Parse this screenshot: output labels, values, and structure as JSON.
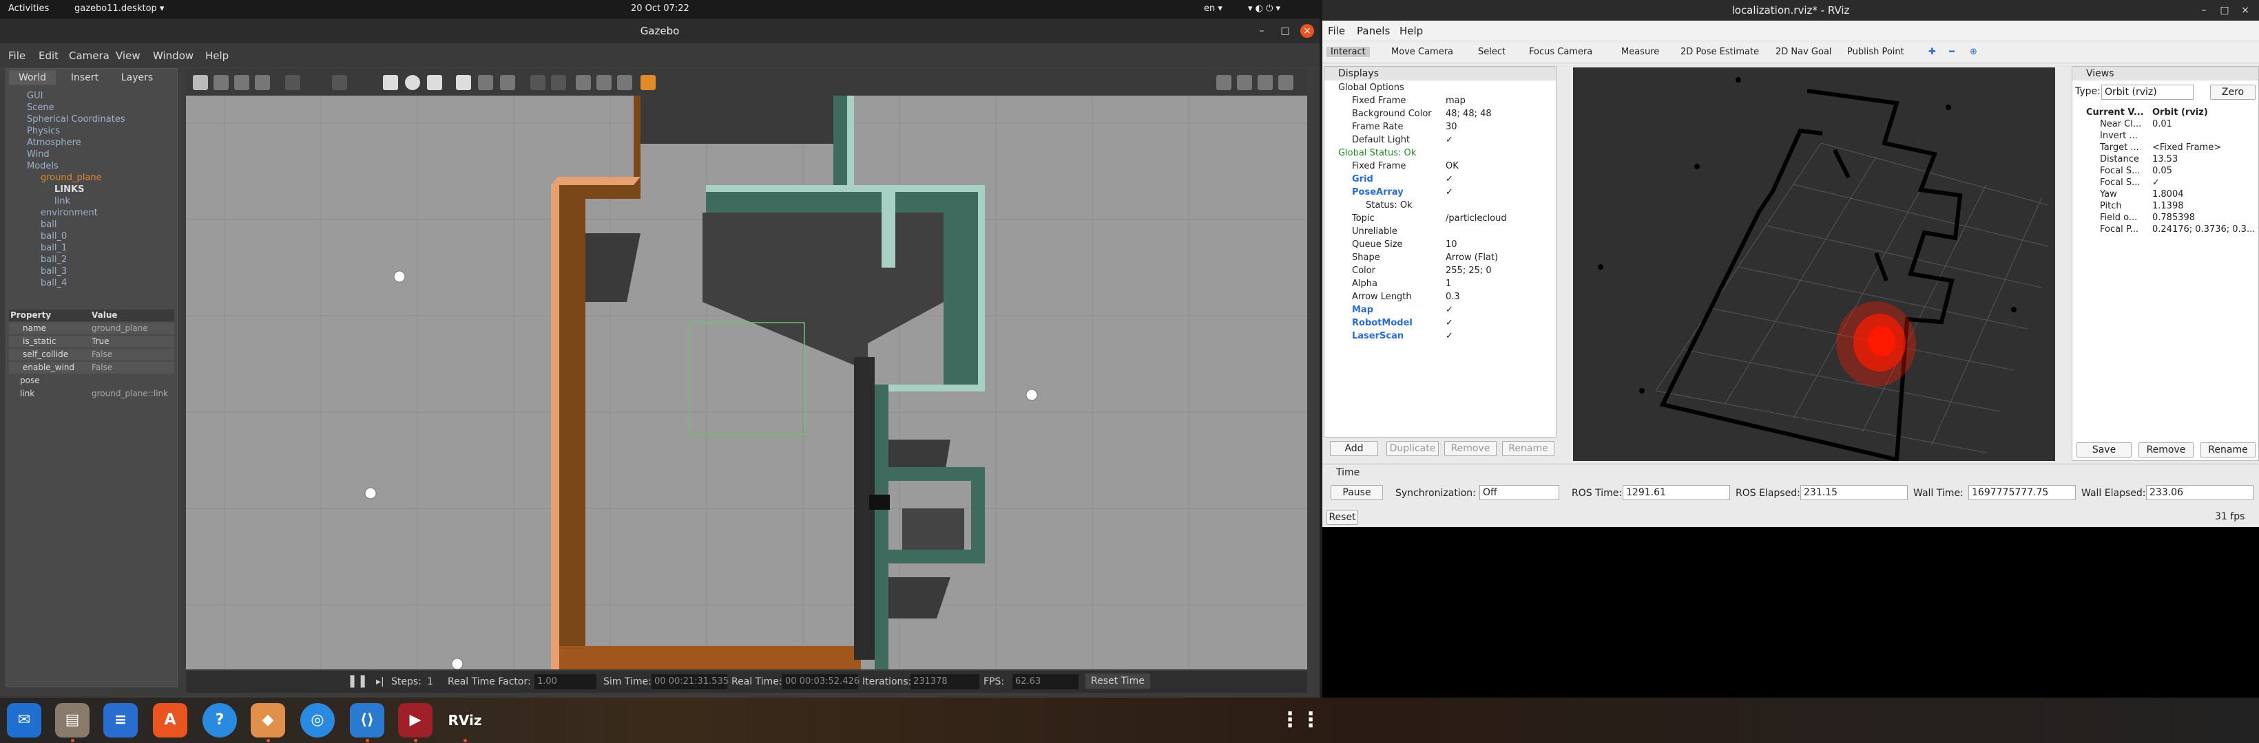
{
  "topbar": {
    "activities": "Activities",
    "app": "gazebo11.desktop ▾",
    "clock": "20 Oct  07:22",
    "lang": "en ▾"
  },
  "gazebo": {
    "title": "Gazebo",
    "menu": [
      "File",
      "Edit",
      "Camera",
      "View",
      "Window",
      "Help"
    ],
    "tabs": [
      "World",
      "Insert",
      "Layers"
    ],
    "tree": [
      "GUI",
      "Scene",
      "Spherical Coordinates",
      "Physics",
      "Atmosphere",
      "Wind",
      "Models",
      "ground_plane",
      "LINKS",
      "link",
      "environment",
      "ball",
      "ball_0",
      "ball_1",
      "ball_2",
      "ball_3",
      "ball_4"
    ],
    "prop_header": [
      "Property",
      "Value"
    ],
    "props": [
      [
        "name",
        "ground_plane"
      ],
      [
        "is_static",
        "True"
      ],
      [
        "self_collide",
        "False"
      ],
      [
        "enable_wind",
        "False"
      ],
      [
        "pose",
        ""
      ],
      [
        "link",
        "ground_plane::link"
      ]
    ],
    "status": {
      "steps_label": "Steps:",
      "steps": "1",
      "rtf_label": "Real Time Factor:",
      "rtf": "1.00",
      "sim_label": "Sim Time:",
      "sim": "00 00:21:31.535",
      "real_label": "Real Time:",
      "real": "00 00:03:52.426",
      "iter_label": "Iterations:",
      "iter": "231378",
      "fps_label": "FPS:",
      "fps": "62.63",
      "reset": "Reset Time"
    }
  },
  "rviz": {
    "title": "localization.rviz* - RViz",
    "menu": [
      "File",
      "Panels",
      "Help"
    ],
    "tools": [
      "Interact",
      "Move Camera",
      "Select",
      "Focus Camera",
      "Measure",
      "2D Pose Estimate",
      "2D Nav Goal",
      "Publish Point"
    ],
    "displays_title": "Displays",
    "displays": [
      [
        "Global Options",
        ""
      ],
      [
        "Fixed Frame",
        "map"
      ],
      [
        "Background Color",
        "48; 48; 48"
      ],
      [
        "Frame Rate",
        "30"
      ],
      [
        "Default Light",
        "✓"
      ],
      [
        "Global Status: Ok",
        ""
      ],
      [
        "Fixed Frame",
        "OK"
      ],
      [
        "Grid",
        "✓"
      ],
      [
        "PoseArray",
        "✓"
      ],
      [
        "Status: Ok",
        ""
      ],
      [
        "Topic",
        "/particlecloud"
      ],
      [
        "Unreliable",
        ""
      ],
      [
        "Queue Size",
        "10"
      ],
      [
        "Shape",
        "Arrow (Flat)"
      ],
      [
        "Color",
        "255; 25; 0"
      ],
      [
        "Alpha",
        "1"
      ],
      [
        "Arrow Length",
        "0.3"
      ],
      [
        "Map",
        "✓"
      ],
      [
        "RobotModel",
        "✓"
      ],
      [
        "LaserScan",
        "✓"
      ]
    ],
    "disp_buttons": [
      "Add",
      "Duplicate",
      "Remove",
      "Rename"
    ],
    "views_title": "Views",
    "views_type_label": "Type:",
    "views_type": "Orbit (rviz)",
    "views_zero": "Zero",
    "views": [
      [
        "Current V...",
        "Orbit (rviz)"
      ],
      [
        "Near Cl...",
        "0.01"
      ],
      [
        "Invert ...",
        ""
      ],
      [
        "Target ...",
        "<Fixed Frame>"
      ],
      [
        "Distance",
        "13.53"
      ],
      [
        "Focal S...",
        "0.05"
      ],
      [
        "Focal S...",
        "✓"
      ],
      [
        "Yaw",
        "1.8004"
      ],
      [
        "Pitch",
        "1.1398"
      ],
      [
        "Field o...",
        "0.785398"
      ],
      [
        "Focal P...",
        "0.24176; 0.3736; 0.3..."
      ]
    ],
    "views_buttons": [
      "Save",
      "Remove",
      "Rename"
    ],
    "time": {
      "title": "Time",
      "pause": "Pause",
      "sync_label": "Synchronization:",
      "sync": "Off",
      "ros_time_label": "ROS Time:",
      "ros_time": "1291.61",
      "ros_el_label": "ROS Elapsed:",
      "ros_el": "231.15",
      "wall_label": "Wall Time:",
      "wall": "1697775777.75",
      "wall_el_label": "Wall Elapsed:",
      "wall_el": "233.06",
      "reset": "Reset",
      "fps": "31 fps"
    }
  },
  "colors": {
    "rviz_bg": "#303030",
    "particles": "#ff1900",
    "walls_teal": "#3e6b5e",
    "walls_orange": "#c77a3a"
  }
}
